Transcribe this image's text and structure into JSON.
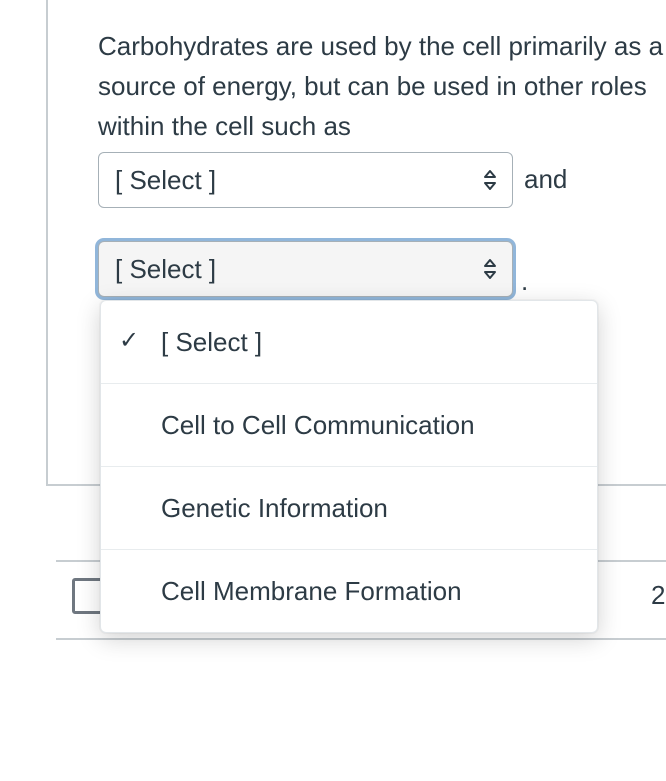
{
  "question": {
    "text": "Carbohydrates are used by the cell primarily as a source of energy, but can be used in other roles within the cell such as",
    "connector": "and",
    "terminator": "."
  },
  "select1": {
    "placeholder": "[ Select ]"
  },
  "select2": {
    "placeholder": "[ Select ]",
    "options": [
      {
        "label": "[ Select ]",
        "selected": true
      },
      {
        "label": "Cell to Cell Communication",
        "selected": false
      },
      {
        "label": "Genetic Information",
        "selected": false
      },
      {
        "label": "Cell Membrane Formation",
        "selected": false
      }
    ]
  },
  "next_row": {
    "points_fragment": "2"
  }
}
